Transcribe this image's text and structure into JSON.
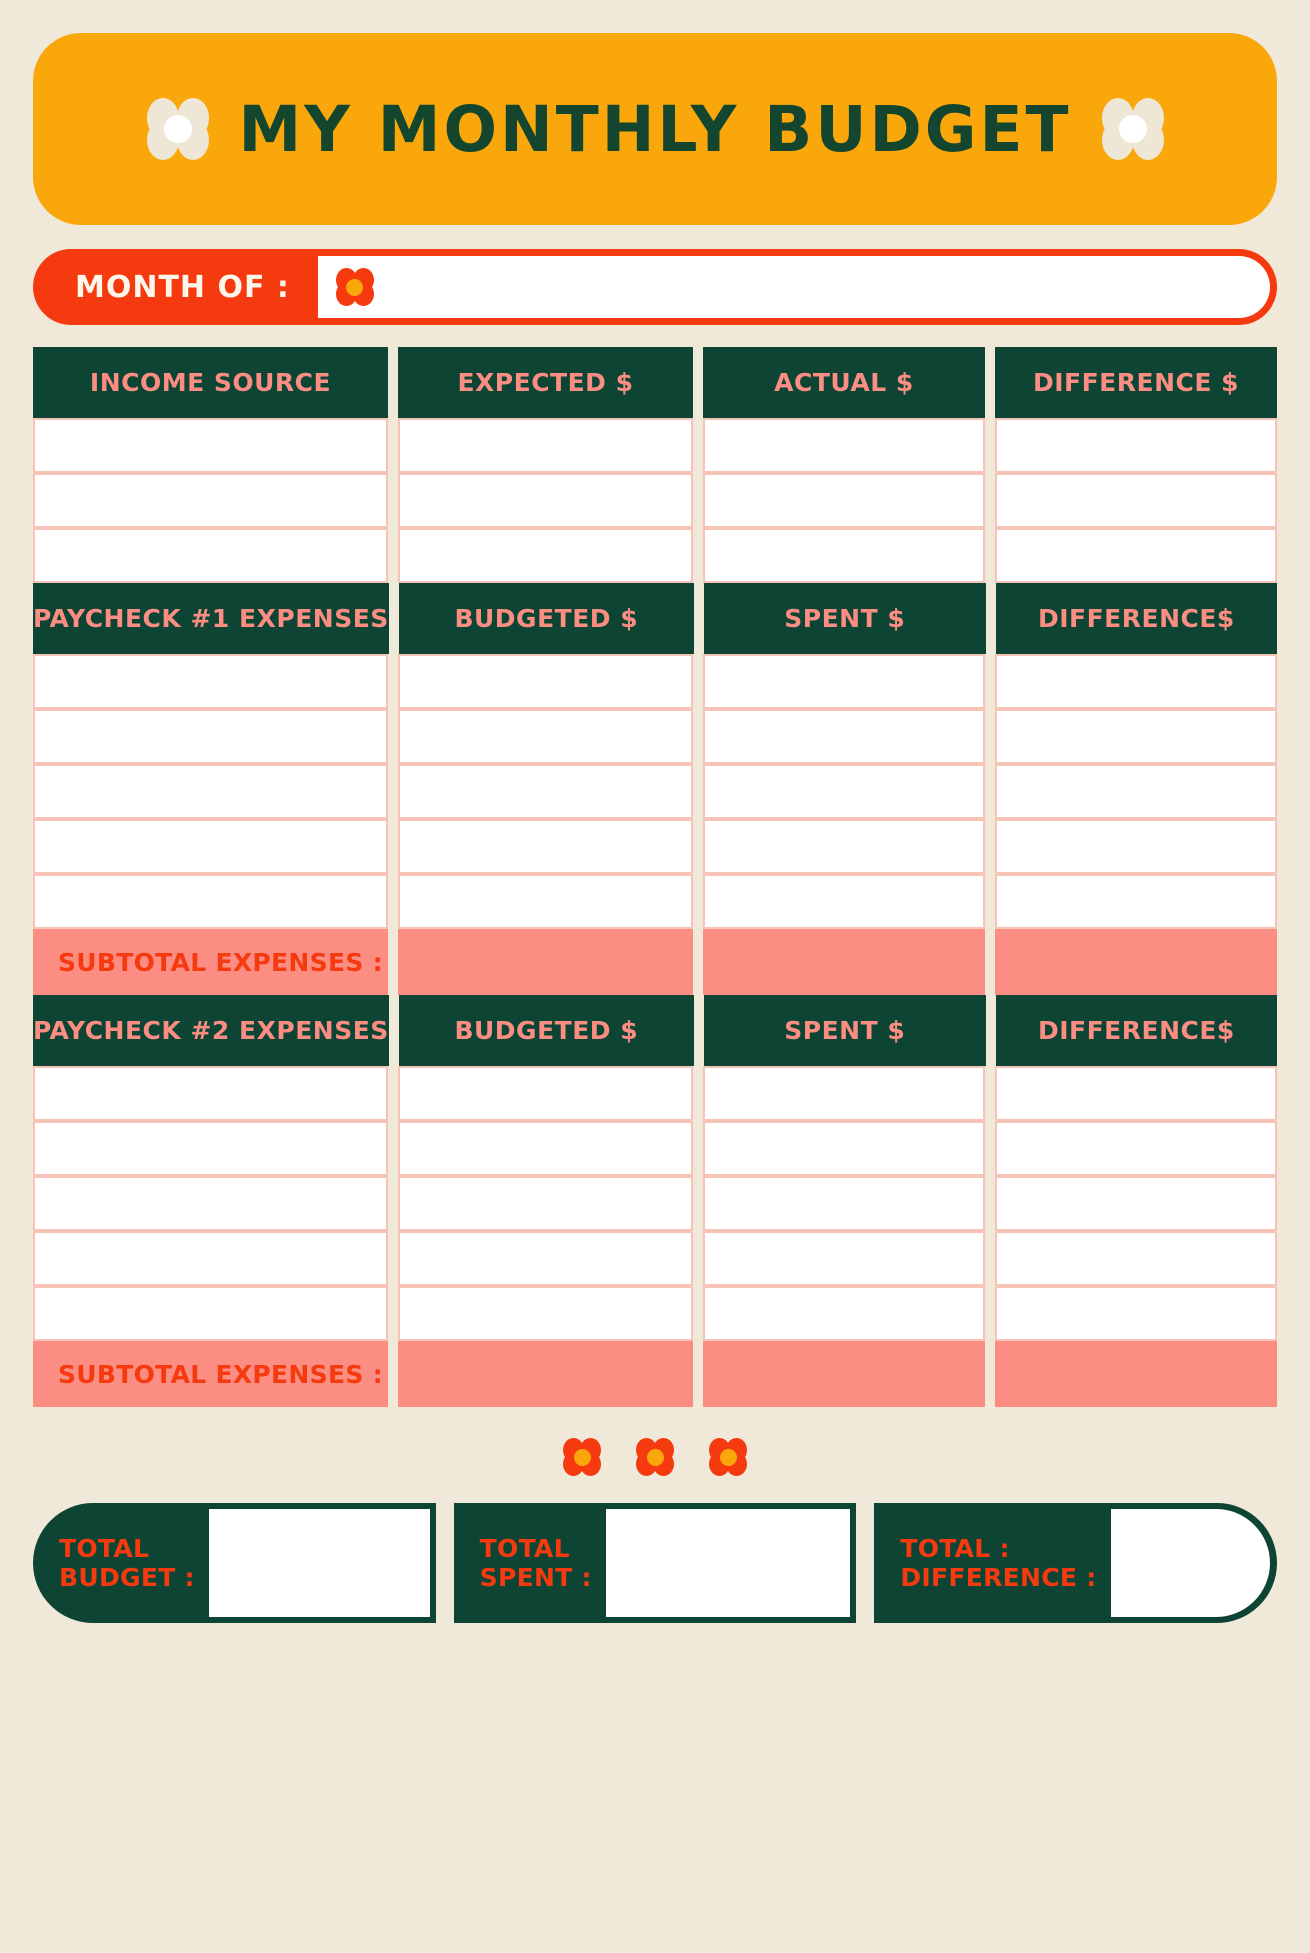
{
  "theme": {
    "background": "#f0e8d8",
    "banner_yellow": "#f9a70a",
    "accent_red": "#f63a0f",
    "dark_green": "#0d4434",
    "salmon": "#fc8d82",
    "cream": "#efe7d6",
    "cell_border": "#f7c3b6"
  },
  "header": {
    "title": "MY MONTHLY BUDGET",
    "flower_left_icon": "flower-icon",
    "flower_right_icon": "flower-icon"
  },
  "month_of": {
    "label": "MONTH OF :",
    "value": "",
    "placeholder": "",
    "flower_icon": "flower-icon"
  },
  "income_section": {
    "headers": [
      "INCOME SOURCE",
      "EXPECTED $",
      "ACTUAL $",
      "DIFFERENCE $"
    ],
    "rows": [
      [
        "",
        "",
        "",
        ""
      ],
      [
        "",
        "",
        "",
        ""
      ],
      [
        "",
        "",
        "",
        ""
      ]
    ]
  },
  "paycheck1_section": {
    "headers": [
      "PAYCHECK #1 EXPENSES",
      "BUDGETED $",
      "SPENT $",
      "DIFFERENCE$"
    ],
    "rows": [
      [
        "",
        "",
        "",
        ""
      ],
      [
        "",
        "",
        "",
        ""
      ],
      [
        "",
        "",
        "",
        ""
      ],
      [
        "",
        "",
        "",
        ""
      ],
      [
        "",
        "",
        "",
        ""
      ]
    ],
    "subtotal_label": "SUBTOTAL EXPENSES :",
    "subtotal_values": [
      "",
      "",
      ""
    ]
  },
  "paycheck2_section": {
    "headers": [
      "PAYCHECK #2 EXPENSES",
      "BUDGETED $",
      "SPENT $",
      "DIFFERENCE$"
    ],
    "rows": [
      [
        "",
        "",
        "",
        ""
      ],
      [
        "",
        "",
        "",
        ""
      ],
      [
        "",
        "",
        "",
        ""
      ],
      [
        "",
        "",
        "",
        ""
      ],
      [
        "",
        "",
        "",
        ""
      ]
    ],
    "subtotal_label": "SUBTOTAL EXPENSES :",
    "subtotal_values": [
      "",
      "",
      ""
    ]
  },
  "divider": {
    "flowers": [
      "flower-icon",
      "flower-icon",
      "flower-icon"
    ]
  },
  "totals": [
    {
      "label": "TOTAL\nBUDGET :",
      "value": ""
    },
    {
      "label": "TOTAL\nSPENT :",
      "value": ""
    },
    {
      "label": "TOTAL :\nDIFFERENCE :",
      "value": ""
    }
  ]
}
